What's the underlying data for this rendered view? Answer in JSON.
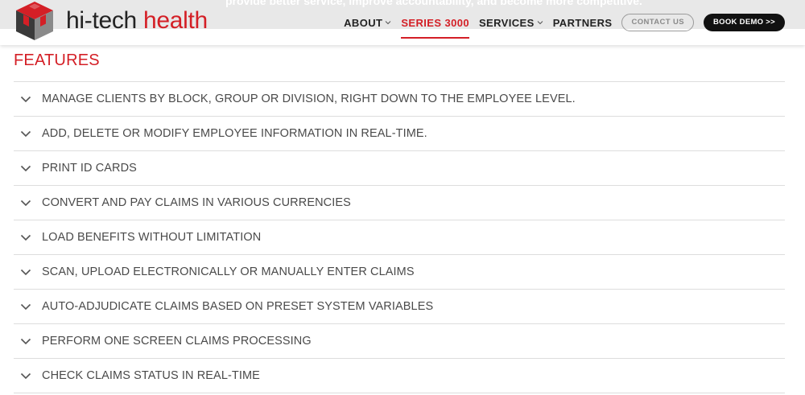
{
  "header": {
    "tagline": "provide better service, improve accountability, and become more competitive.",
    "logo": {
      "text_main": "hi-tech ",
      "text_accent": "health",
      "colors": {
        "red": "#d41f26",
        "dark": "#3a3a3a",
        "mid": "#8a8a8a"
      }
    },
    "nav": [
      {
        "label": "ABOUT",
        "has_dropdown": true,
        "active": false
      },
      {
        "label": "SERIES 3000",
        "has_dropdown": false,
        "active": true
      },
      {
        "label": "SERVICES",
        "has_dropdown": true,
        "active": false
      },
      {
        "label": "PARTNERS",
        "has_dropdown": false,
        "active": false
      }
    ],
    "contact_button": "CONTACT US",
    "demo_button": "BOOK DEMO >>"
  },
  "features": {
    "title": "FEATURES",
    "items": [
      "MANAGE CLIENTS BY BLOCK, GROUP OR DIVISION, RIGHT DOWN TO THE EMPLOYEE LEVEL.",
      "ADD, DELETE OR MODIFY EMPLOYEE INFORMATION IN REAL-TIME.",
      "PRINT ID CARDS",
      "CONVERT AND PAY CLAIMS IN VARIOUS CURRENCIES",
      "LOAD BENEFITS WITHOUT LIMITATION",
      "SCAN, UPLOAD ELECTRONICALLY OR MANUALLY ENTER CLAIMS",
      "AUTO-ADJUDICATE CLAIMS BASED ON PRESET SYSTEM VARIABLES",
      "PERFORM ONE SCREEN CLAIMS PROCESSING",
      "CHECK CLAIMS STATUS IN REAL-TIME"
    ]
  },
  "theme": {
    "accent": "#d41f26",
    "text": "#4a4a4a",
    "divider": "#dddddd"
  }
}
